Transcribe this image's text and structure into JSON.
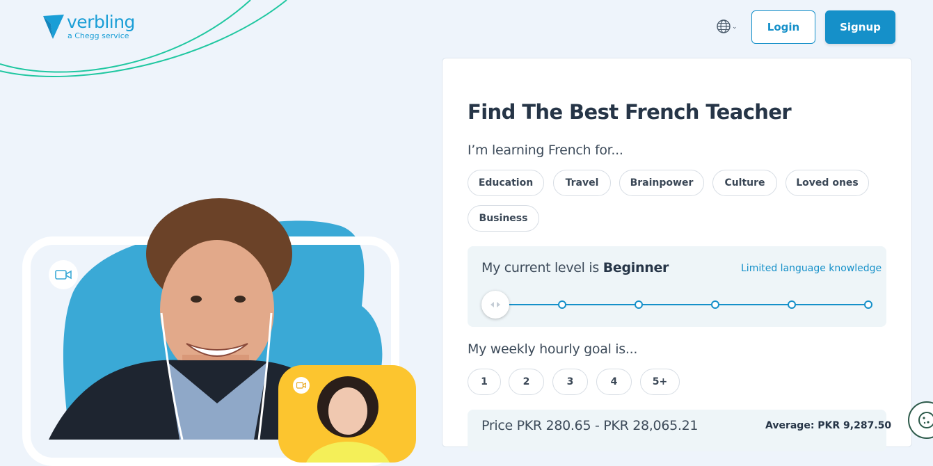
{
  "brand": {
    "name": "verbling",
    "tagline": "a Chegg service",
    "color": "#1a9ed6"
  },
  "header": {
    "language_icon": "globe-icon",
    "login_label": "Login",
    "signup_label": "Signup"
  },
  "form": {
    "title": "Find The Best French Teacher",
    "purpose_question": "I’m learning French for...",
    "purposes": [
      "Education",
      "Travel",
      "Brainpower",
      "Culture",
      "Loved ones",
      "Business"
    ],
    "level_prefix": "My current level is",
    "level_value": "Beginner",
    "level_description": "Limited language knowledge",
    "level_steps": 6,
    "level_selected_index": 0,
    "goal_question": "My weekly hourly goal is...",
    "goal_options": [
      "1",
      "2",
      "3",
      "4",
      "5+"
    ],
    "price_range": "Price PKR 280.65 - PKR 28,065.21",
    "price_average": "Average: PKR 9,287.50"
  },
  "colors": {
    "accent": "#1590c9",
    "curve": "#1fc7a0",
    "blob": "#3aa9d6",
    "card": "#fcc52f"
  },
  "icons": {
    "camera": "video-camera-icon",
    "cookie": "cookie-icon",
    "slider": "slider-arrows-icon"
  }
}
